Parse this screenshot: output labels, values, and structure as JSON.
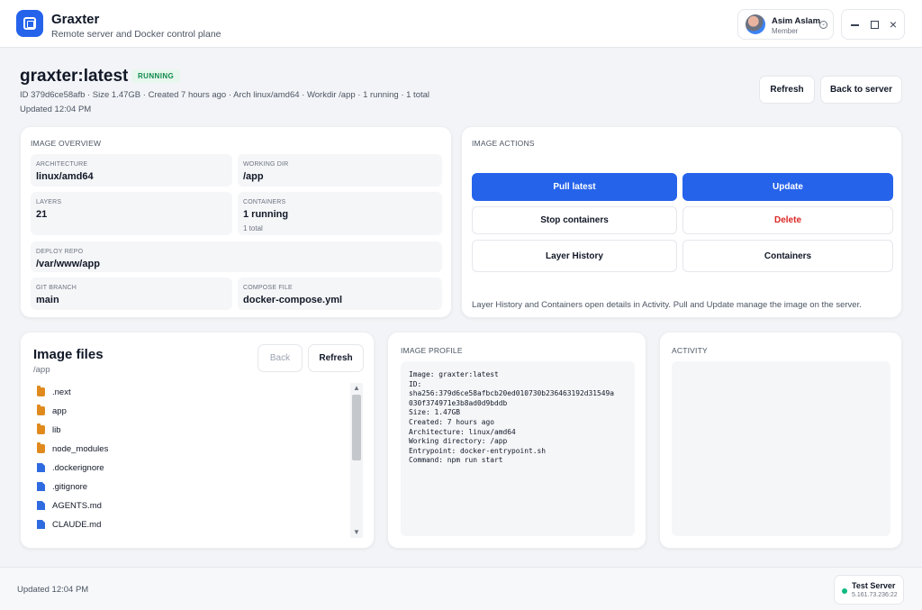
{
  "app": {
    "title": "Graxter",
    "subtitle": "Remote server and Docker control plane"
  },
  "user": {
    "name": "Asim Aslam",
    "role": "Member"
  },
  "window_controls": {
    "minimize": "minimize-icon",
    "maximize": "maximize-icon",
    "close": "×"
  },
  "header": {
    "title": "graxter:latest",
    "status": "RUNNING",
    "meta": "ID 379d6ce58afb · Size 1.47GB · Created 7 hours ago · Arch linux/amd64 · Workdir /app · 1 running · 1 total",
    "updated": "Updated 12:04 PM",
    "refresh_label": "Refresh",
    "back_label": "Back to server"
  },
  "overview": {
    "label": "IMAGE OVERVIEW",
    "fields": [
      {
        "label": "ARCHITECTURE",
        "value": "linux/amd64"
      },
      {
        "label": "WORKING DIR",
        "value": "/app"
      },
      {
        "label": "LAYERS",
        "value": "21"
      },
      {
        "label": "CONTAINERS",
        "value": "1 running",
        "sub": "1 total"
      },
      {
        "label": "DEPLOY REPO",
        "value": "/var/www/app"
      },
      {
        "label": "GIT BRANCH",
        "value": "main"
      },
      {
        "label": "COMPOSE FILE",
        "value": "docker-compose.yml"
      }
    ]
  },
  "actions": {
    "label": "IMAGE ACTIONS",
    "pull": "Pull latest",
    "update": "Update",
    "stop": "Stop containers",
    "delete": "Delete",
    "layer_history": "Layer History",
    "containers": "Containers",
    "note": "Layer History and Containers open details in Activity. Pull and Update manage the image on the server."
  },
  "files": {
    "title": "Image files",
    "path": "/app",
    "back_label": "Back",
    "refresh_label": "Refresh",
    "items": [
      {
        "name": ".next",
        "type": "folder"
      },
      {
        "name": "app",
        "type": "folder"
      },
      {
        "name": "lib",
        "type": "folder"
      },
      {
        "name": "node_modules",
        "type": "folder"
      },
      {
        "name": ".dockerignore",
        "type": "file"
      },
      {
        "name": ".gitignore",
        "type": "file"
      },
      {
        "name": "AGENTS.md",
        "type": "file"
      },
      {
        "name": "CLAUDE.md",
        "type": "file"
      }
    ]
  },
  "profile": {
    "label": "IMAGE PROFILE",
    "lines": [
      "Image: graxter:latest",
      "ID:",
      "sha256:379d6ce58afbcb20ed010730b236463192d31549a",
      "030f374971e3b8ad0d9bddb",
      "Size: 1.47GB",
      "Created: 7 hours ago",
      "Architecture: linux/amd64",
      "Working directory: /app",
      "Entrypoint: docker-entrypoint.sh",
      "Command: npm run start"
    ]
  },
  "activity": {
    "label": "ACTIVITY"
  },
  "footer": {
    "updated": "Updated 12:04 PM",
    "server_name": "Test Server",
    "server_ip": "5.161.73.236:22"
  },
  "colors": {
    "accent": "#2563eb",
    "danger": "#dc2626",
    "running": "#0f8a4a",
    "online": "#10b981",
    "folder": "#e08a1e",
    "file": "#2f6be0"
  }
}
